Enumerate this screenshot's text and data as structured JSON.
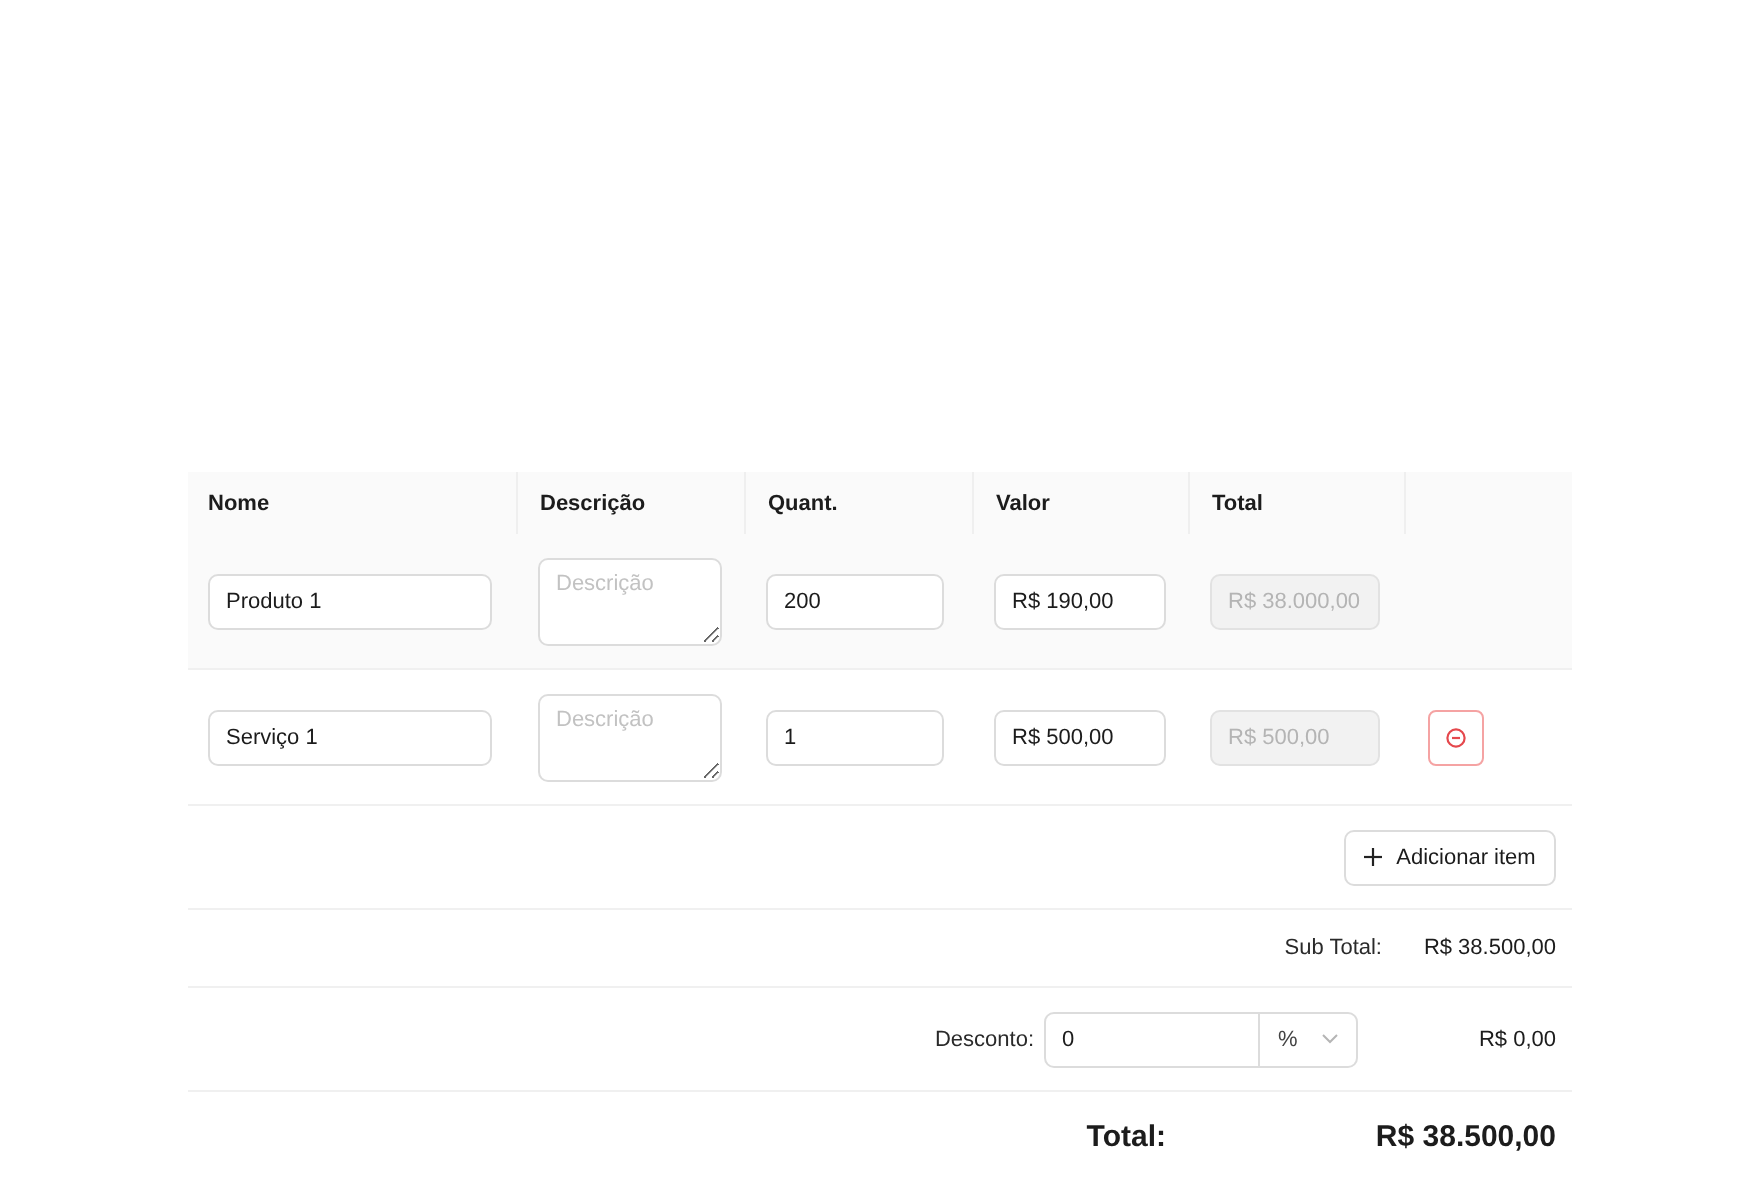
{
  "table": {
    "columns": [
      "Nome",
      "Descrição",
      "Quant.",
      "Valor",
      "Total"
    ],
    "rows": [
      {
        "highlighted": true,
        "name": "Produto 1",
        "description": {
          "placeholder": "Descrição"
        },
        "quantity": "200",
        "price": "R$ 190,00",
        "total": {
          "value": "R$ 38.000,00",
          "disabled": true
        },
        "removable": false
      },
      {
        "highlighted": false,
        "name": "Serviço 1",
        "description": {
          "placeholder": "Descrição"
        },
        "quantity": "1",
        "price": "R$ 500,00",
        "total": {
          "value": "R$ 500,00",
          "disabled": true
        },
        "removable": true
      }
    ]
  },
  "add_button": {
    "label": "Adicionar item"
  },
  "subtotal": {
    "label": "Sub Total:",
    "value": "R$ 38.500,00"
  },
  "discount": {
    "label": "Desconto:",
    "value": "0",
    "unit": "%",
    "amount": "R$ 0,00"
  },
  "total": {
    "label": "Total:",
    "value": "R$ 38.500,00"
  }
}
